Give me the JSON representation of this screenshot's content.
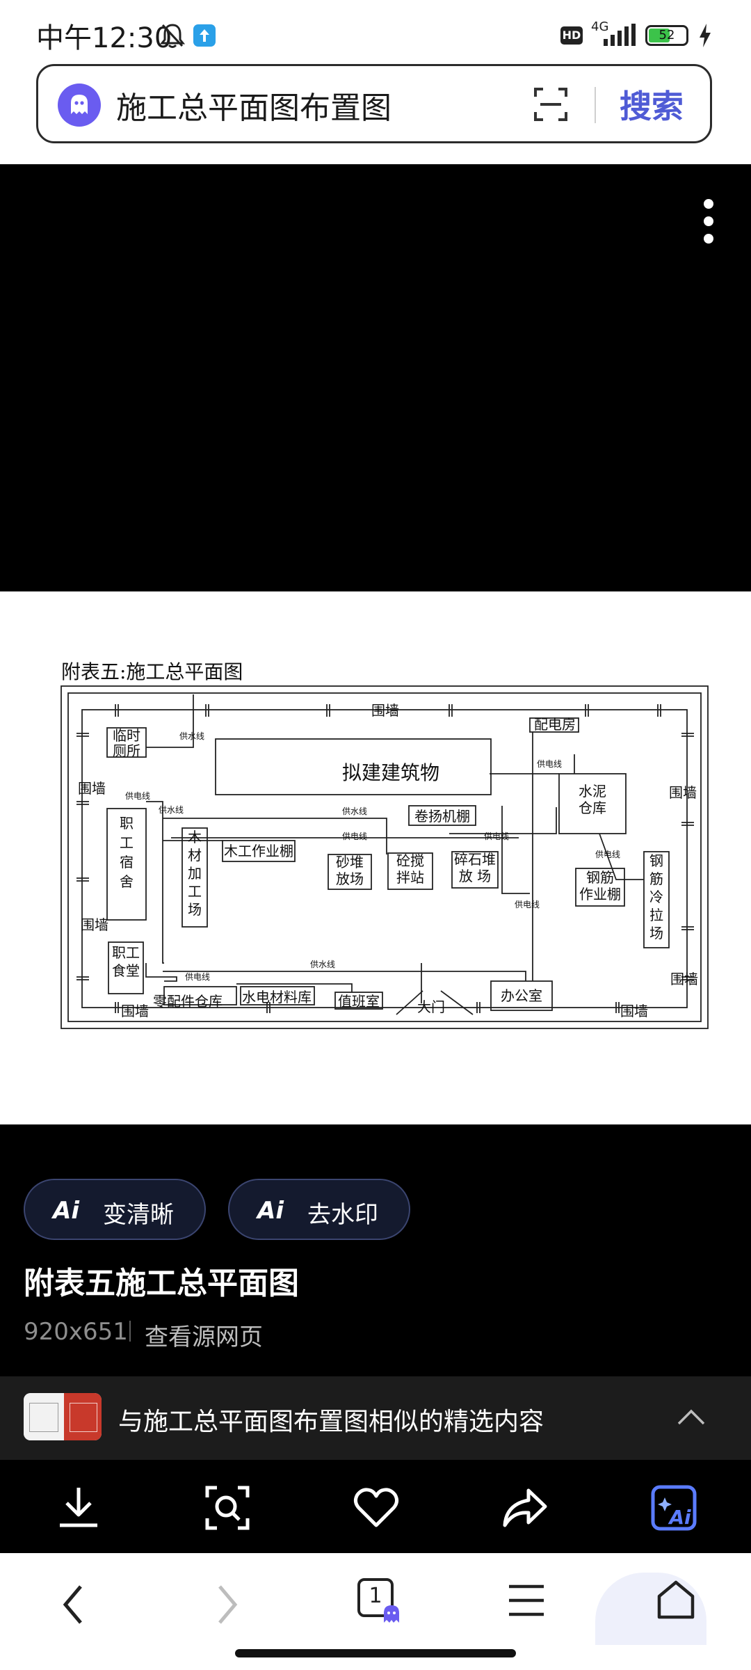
{
  "status_bar": {
    "time": "中午12:30",
    "network": "4G",
    "battery": "52",
    "hd": "HD"
  },
  "search": {
    "query": "施工总平面图布置图",
    "search_button": "搜索"
  },
  "diagram": {
    "title": "附表五:施工总平面图",
    "labels": {
      "wall_top": "围墙",
      "wall_left1": "围墙",
      "wall_left2": "围墙",
      "wall_right1": "围墙",
      "wall_right2": "围墙",
      "wall_bottom1": "围墙",
      "wall_bottom2": "围墙",
      "toilet": "临时\n厕所",
      "dorm": "职\n工\n宿\n舍",
      "canteen": "职工\n食堂",
      "building": "拟建建筑物",
      "power_room": "配电房",
      "cement": "水泥\n仓库",
      "winch": "卷扬机棚",
      "wood_shed": "木工作业棚",
      "wood_yard": "木\n材\n加\n工\n场",
      "sand": "砂堆\n放场",
      "mixer": "砼搅\n拌站",
      "gravel": "碎石堆\n放 场",
      "rebar_shed": "钢筋\n作业棚",
      "rebar_yard": "钢\n筋\n冷\n拉\n场",
      "parts": "零配件仓库",
      "plumbing": "水电材料库",
      "duty": "值班室",
      "gate": "大门",
      "office": "办公室",
      "water1": "供水线",
      "water2": "供水线",
      "water3": "供水线",
      "water4": "供水线",
      "power1": "供电线",
      "power2": "供电线",
      "power3": "供电线",
      "power4": "供电线",
      "power5": "供电线",
      "power6": "供电线",
      "power7": "供电线"
    }
  },
  "chips": [
    {
      "ai": "Ai",
      "label": "变清晰"
    },
    {
      "ai": "Ai",
      "label": "去水印"
    }
  ],
  "image_info": {
    "title": "附表五施工总平面图",
    "size": "920x651",
    "source_link": "查看源网页"
  },
  "similar": {
    "text": "与施工总平面图布置图相似的精选内容"
  },
  "actions": [
    "download-icon",
    "image-search-icon",
    "heart-icon",
    "share-icon",
    "ai-icon"
  ],
  "nav": {
    "tab_count": "1"
  },
  "colors": {
    "accent": "#4f5bd5",
    "chip_bg": "#141a2e",
    "ai_blue": "#5b7cff"
  }
}
